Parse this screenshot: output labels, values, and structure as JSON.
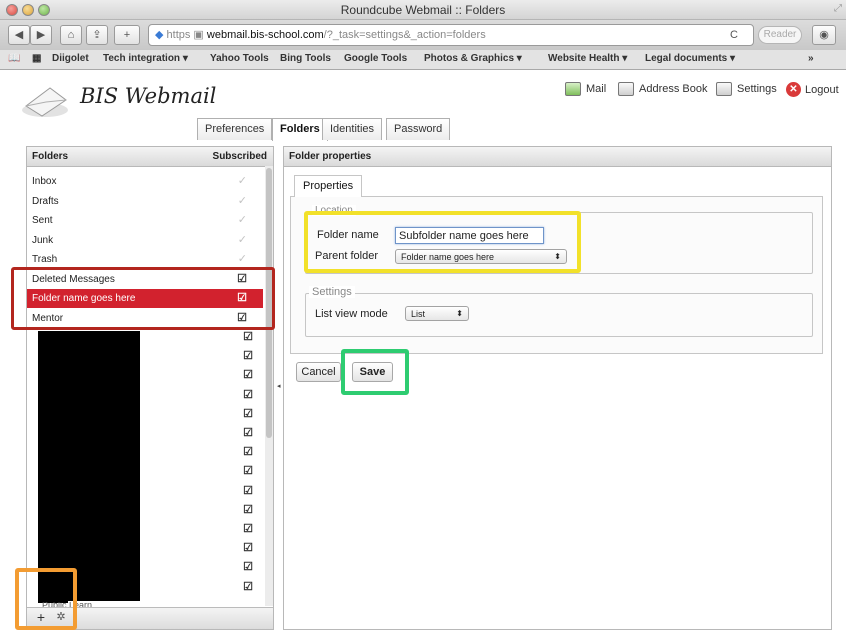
{
  "window": {
    "title": "Roundcube Webmail :: Folders"
  },
  "browser": {
    "nav": {
      "back": "◀",
      "forward": "▶",
      "reload": "C",
      "add": "+"
    },
    "url": {
      "scheme": "https",
      "host": "webmail.bis-school.com",
      "path": "/?_task=settings&_action=folders"
    },
    "reader": "Reader",
    "bookmarks": [
      "Diigolet",
      "Tech integration ▾",
      "Yahoo Tools",
      "Bing Tools",
      "Google Tools",
      "Photos & Graphics ▾",
      "Website Health ▾",
      "Legal documents ▾"
    ],
    "bookmarks_overflow": "»"
  },
  "app": {
    "logo": "BIS Webmail",
    "topnav": {
      "mail": "Mail",
      "address_book": "Address Book",
      "settings": "Settings",
      "logout": "Logout"
    },
    "tabs": [
      "Preferences",
      "Folders",
      "Identities",
      "Password"
    ],
    "active_tab": "Folders"
  },
  "folders_panel": {
    "header": "Folders",
    "subscribed_header": "Subscribed",
    "folders": [
      {
        "name": "Inbox",
        "subscribed": true,
        "locked": true
      },
      {
        "name": "Drafts",
        "subscribed": true,
        "locked": true
      },
      {
        "name": "Sent",
        "subscribed": true,
        "locked": true
      },
      {
        "name": "Junk",
        "subscribed": true,
        "locked": true
      },
      {
        "name": "Trash",
        "subscribed": true,
        "locked": true
      },
      {
        "name": "Deleted Messages",
        "subscribed": true,
        "locked": false
      },
      {
        "name": "Folder name goes here",
        "subscribed": true,
        "locked": false,
        "selected": true
      },
      {
        "name": "Mentor",
        "subscribed": true,
        "locked": false
      }
    ],
    "hidden_rows_checkmarks": 14,
    "partial_last_row": "Public Learn",
    "add_button": "+",
    "gear_button": "✲"
  },
  "properties_panel": {
    "header": "Folder properties",
    "tab": "Properties",
    "location_legend": "Location",
    "folder_name_label": "Folder name",
    "folder_name_value": "Subfolder name goes here",
    "parent_folder_label": "Parent folder",
    "parent_folder_value": "Folder name goes here",
    "settings_legend": "Settings",
    "list_view_label": "List view mode",
    "list_view_value": "List",
    "cancel": "Cancel",
    "save": "Save"
  },
  "glyphs": {
    "check": "✓",
    "check_on": "☑",
    "select_arrow": "⬍",
    "logout": "✕"
  },
  "highlight_colors": {
    "red": "#b3261e",
    "yellow": "#f2e12a",
    "green": "#2ecc71",
    "orange": "#f39c32",
    "selected_row": "#d2222e"
  }
}
